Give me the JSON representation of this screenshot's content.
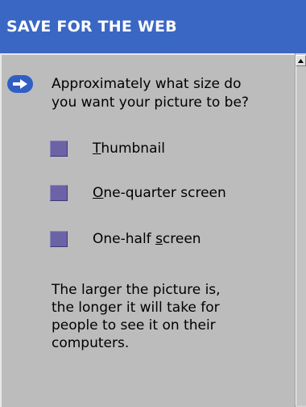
{
  "header": {
    "title": "SAVE FOR THE WEB"
  },
  "prompt": {
    "line1": "Approximately what size do",
    "line2": "you want your picture to be?"
  },
  "options": [
    {
      "label": "Thumbnail",
      "mnemonic_index": 0
    },
    {
      "label": "One-quarter screen",
      "mnemonic_index": 0
    },
    {
      "label": "One-half screen",
      "mnemonic_index": 9
    }
  ],
  "note": {
    "line1": "The larger the picture is,",
    "line2": "the longer it will take for",
    "line3": "people to see it on their",
    "line4": "computers."
  },
  "colors": {
    "header_bg": "#3a67c4",
    "pane_bg": "#bcbcbc",
    "swatch": "#6b63a6",
    "arrow": "#2f5fc4"
  },
  "icons": {
    "prompt": "arrow-right-icon",
    "scroll": "scroll-up-arrow-icon"
  }
}
